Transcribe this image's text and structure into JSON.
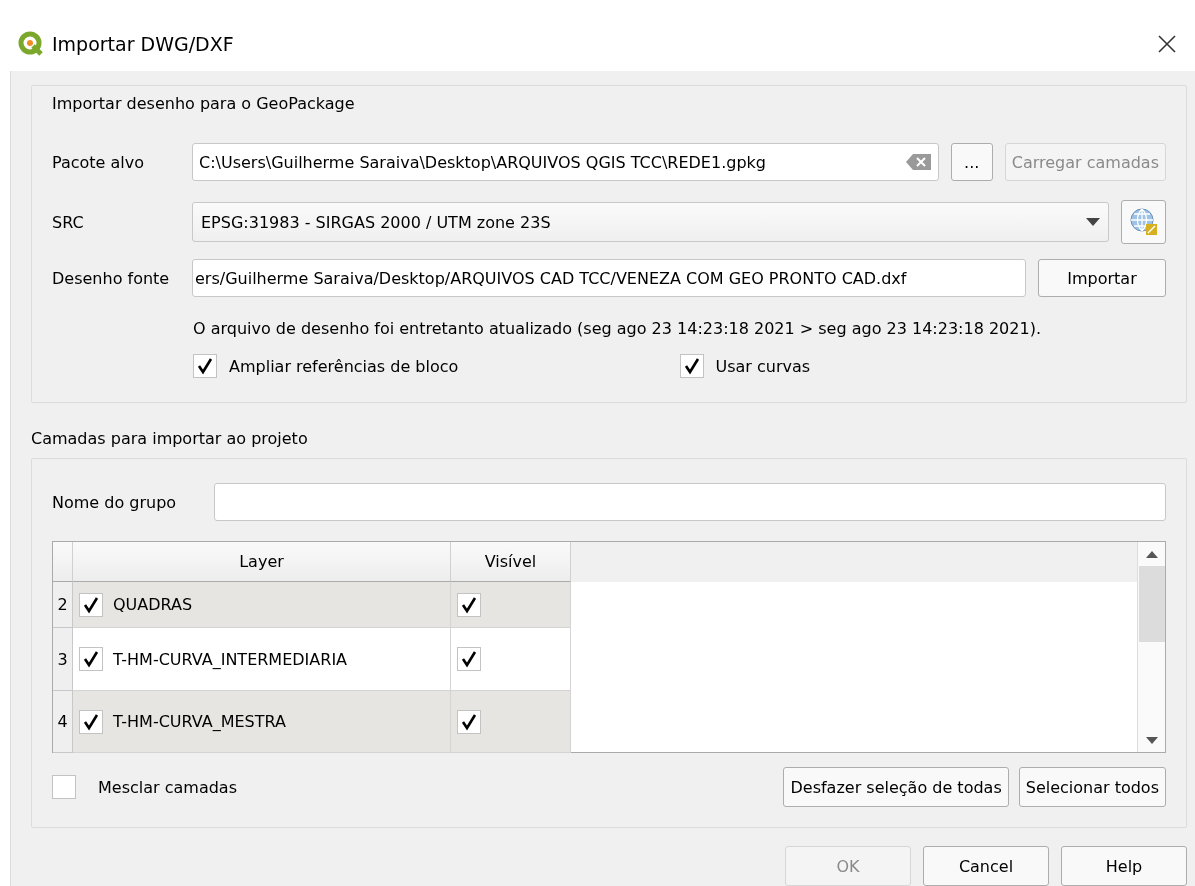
{
  "window": {
    "title": "Importar DWG/DXF"
  },
  "import_group": {
    "title": "Importar desenho para o GeoPackage",
    "target_package": {
      "label": "Pacote alvo",
      "value": "C:\\Users\\Guilherme Saraiva\\Desktop\\ARQUIVOS QGIS TCC\\REDE1.gpkg",
      "browse": "...",
      "load": {
        "label": "Carregar camadas",
        "disabled": true
      }
    },
    "crs": {
      "label": "SRC",
      "value": "EPSG:31983 - SIRGAS 2000 / UTM zone 23S"
    },
    "source_drawing": {
      "label": "Desenho fonte",
      "value": "ers/Guilherme Saraiva/Desktop/ARQUIVOS CAD TCC/VENEZA COM GEO PRONTO CAD.dxf",
      "button": "Importar"
    },
    "message": "O arquivo de desenho foi entretanto atualizado (seg ago 23 14:23:18 2021 > seg ago 23 14:23:18 2021).",
    "options": [
      {
        "label": "Ampliar referências de bloco",
        "checked": true
      },
      {
        "label": "Usar curvas",
        "checked": true
      }
    ]
  },
  "layers_group": {
    "title": "Camadas para importar ao projeto",
    "group_name": {
      "label": "Nome do grupo"
    },
    "table": {
      "columns": [
        "Layer",
        "Visível"
      ],
      "rows": [
        {
          "number": "2",
          "layer": "QUADRAS",
          "checked": true,
          "visible": true
        },
        {
          "number": "3",
          "layer": "T-HM-CURVA_INTERMEDIARIA",
          "checked": true,
          "visible": true
        },
        {
          "number": "4",
          "layer": "T-HM-CURVA_MESTRA",
          "checked": true,
          "visible": true
        }
      ]
    },
    "merge": {
      "label": "Mesclar camadas",
      "checked": false
    },
    "buttons": [
      "Desfazer seleção de todas",
      "Selecionar todos"
    ]
  },
  "dialog_buttons": [
    {
      "label": "OK",
      "disabled": true
    },
    {
      "label": "Cancel",
      "disabled": false
    },
    {
      "label": "Help",
      "disabled": false
    }
  ]
}
